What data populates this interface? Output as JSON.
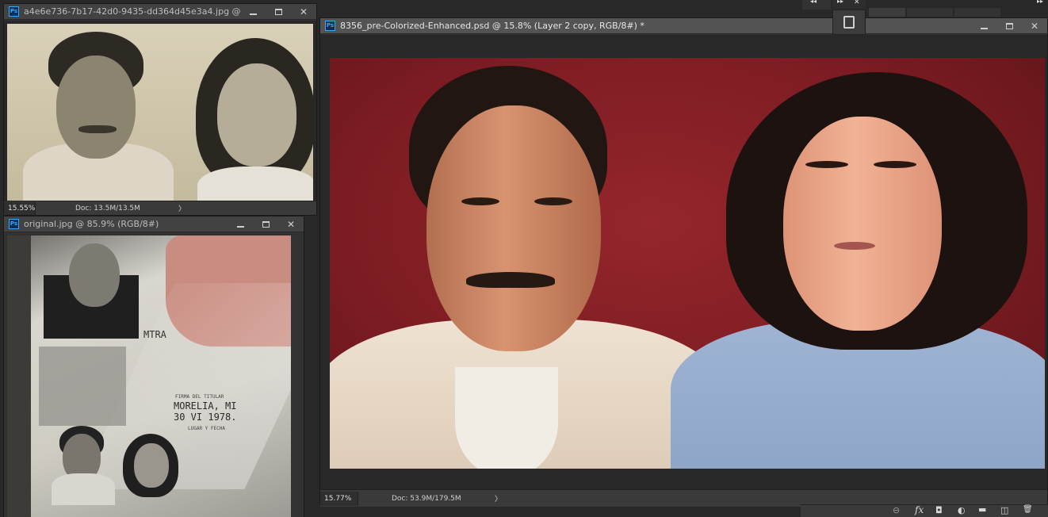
{
  "windows": {
    "restored": {
      "title": "a4e6e736-7b17-42d0-9435-dd364d45e3a4.jpg @ 1...",
      "zoom": "15.55%",
      "doc": "Doc: 13.5M/13.5M"
    },
    "original": {
      "title": "original.jpg @ 85.9% (RGB/8#)"
    },
    "main": {
      "title": "8356_pre-Colorized-Enhanced.psd @ 15.8% (Layer 2 copy, RGB/8#) *",
      "zoom": "15.77%",
      "doc": "Doc: 53.9M/179.5M"
    }
  },
  "original_photo_text": {
    "line1": "MTRA",
    "line2": "FIRMA DEL TITULAR",
    "line3": "MORELIA, MI",
    "line4": "30  VI  1978.",
    "line5": "LUGAR Y FECHA"
  },
  "icons": {
    "ps": "Ps",
    "chevron": "〉",
    "close": "✕",
    "collapse": "◂◂",
    "expand": "▸▸",
    "link": "⊖",
    "fx": "fx",
    "mask": "◘",
    "adjust": "◐",
    "folder": "▬",
    "new": "◫",
    "trash": "🗑"
  },
  "colors": {
    "accent": "#31a8ff",
    "backdrop": "#7c1c22"
  }
}
